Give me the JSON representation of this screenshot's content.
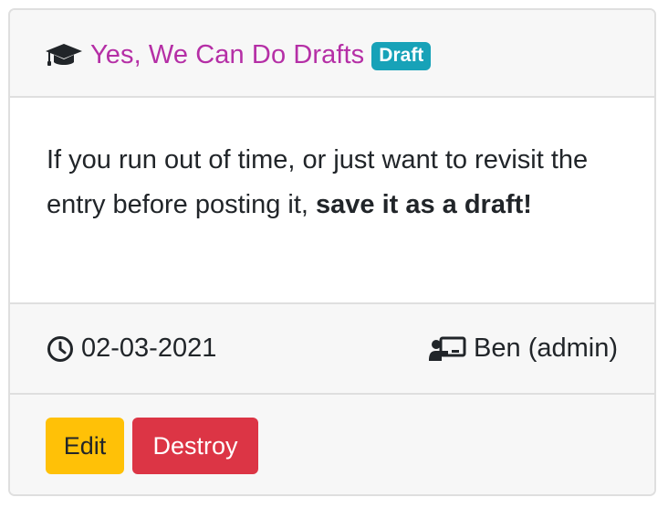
{
  "post": {
    "title": "Yes, We Can Do Drafts",
    "badge": "Draft",
    "body_intro": "If you run out of time, or just want to revisit the entry before posting it, ",
    "body_bold": "save it as a draft!",
    "date": "02-03-2021",
    "author": "Ben (admin)"
  },
  "actions": {
    "edit_label": "Edit",
    "destroy_label": "Destroy"
  },
  "icons": {
    "title": "graduation-cap-icon",
    "date": "clock-icon",
    "author": "chalkboard-teacher-icon"
  },
  "colors": {
    "title_link": "#b52fa6",
    "badge": "#17a2b8",
    "edit_button": "#ffc107",
    "destroy_button": "#dc3545"
  }
}
